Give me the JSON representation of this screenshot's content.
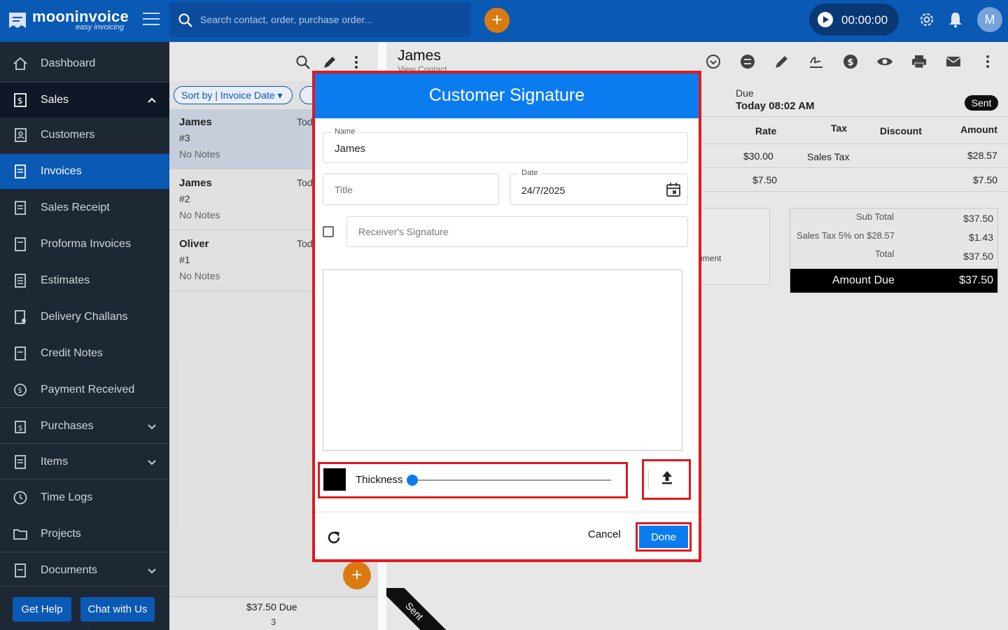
{
  "app": {
    "brand": "mooninvoice",
    "tagline": "easy invoicing",
    "search_placeholder": "Search contact, order, purchase order...",
    "timer": "00:00:00",
    "avatar_letter": "M",
    "accent": "#0b5bb8",
    "fab_color": "#e07d14"
  },
  "sidebar": {
    "items": [
      {
        "label": "Dashboard"
      },
      {
        "label": "Sales"
      },
      {
        "label": "Customers"
      },
      {
        "label": "Invoices"
      },
      {
        "label": "Sales Receipt"
      },
      {
        "label": "Proforma Invoices"
      },
      {
        "label": "Estimates"
      },
      {
        "label": "Delivery Challans"
      },
      {
        "label": "Credit Notes"
      },
      {
        "label": "Payment Received"
      },
      {
        "label": "Purchases"
      },
      {
        "label": "Items"
      },
      {
        "label": "Time Logs"
      },
      {
        "label": "Projects"
      },
      {
        "label": "Documents"
      }
    ],
    "get_help": "Get Help",
    "chat": "Chat with Us"
  },
  "list": {
    "sort_label": "Sort by | Invoice Date",
    "rows": [
      {
        "name": "James",
        "date": "Tod",
        "number": "#3",
        "notes": "No Notes"
      },
      {
        "name": "James",
        "date": "Tod",
        "number": "#2",
        "notes": "No Notes"
      },
      {
        "name": "Oliver",
        "date": "Tod",
        "number": "#1",
        "notes": "No Notes"
      }
    ],
    "footer_total": "$37.50",
    "footer_due": "Due",
    "footer_count": "3"
  },
  "detail": {
    "customer": "James",
    "view_contact": "View Contact",
    "due_label": "Due",
    "due_value": "Today 08:02 AM",
    "status": "Sent",
    "columns": {
      "rate": "Rate",
      "tax": "Tax",
      "discount": "Discount",
      "amount": "Amount"
    },
    "rows": [
      {
        "rate": "$30.00",
        "tax": "Sales Tax",
        "amount": "$28.57"
      },
      {
        "rate": "$7.50",
        "tax": "",
        "amount": "$7.50"
      }
    ],
    "notes_fragment": "ument",
    "totals": {
      "subtotal_label": "Sub Total",
      "subtotal": "$37.50",
      "tax_label": "Sales Tax 5% on $28.57",
      "tax": "$1.43",
      "total_label": "Total",
      "total": "$37.50",
      "amount_due_label": "Amount Due",
      "amount_due": "$37.50"
    },
    "ribbon": "Sent"
  },
  "modal": {
    "title": "Customer Signature",
    "name_label": "Name",
    "name_value": "James",
    "title_placeholder": "Title",
    "date_label": "Date",
    "date_value": "24/7/2025",
    "receiver_placeholder": "Receiver's Signature",
    "thickness_label": "Thickness",
    "thickness_level": 0.0,
    "pen_color": "#000000",
    "cancel": "Cancel",
    "done": "Done",
    "header_color": "#0b7cf0",
    "highlight_color": "#e0191f"
  }
}
